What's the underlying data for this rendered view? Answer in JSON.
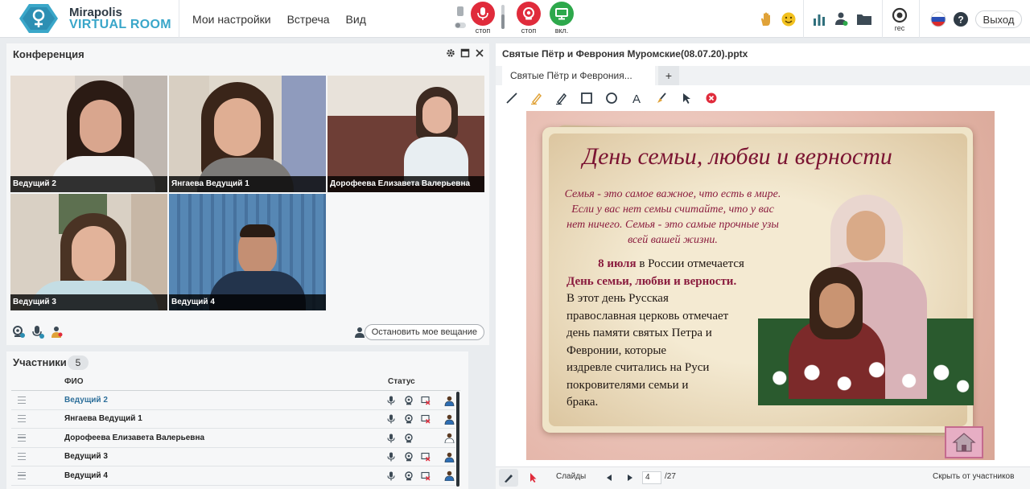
{
  "app": {
    "logo_line1": "Mirapolis",
    "logo_line2": "VIRTUAL ROOM",
    "menu": [
      "Мои настройки",
      "Встреча",
      "Вид"
    ],
    "media_buttons": [
      {
        "label": "стоп",
        "icon": "microphone-icon",
        "color": "#e02b3b"
      },
      {
        "label": "стоп",
        "icon": "webcam-icon",
        "color": "#e02b3b"
      },
      {
        "label": "вкл.",
        "icon": "screen-share-icon",
        "color": "#2da84b"
      }
    ],
    "rec_label": "rec",
    "exit_label": "Выход"
  },
  "conference": {
    "title": "Конференция",
    "videos": [
      {
        "name": "Ведущий 2"
      },
      {
        "name": "Янгаева Ведущий 1"
      },
      {
        "name": "Дорофеева Елизавета  Валерьевна"
      },
      {
        "name": "Ведущий 3"
      },
      {
        "name": "Ведущий 4"
      }
    ],
    "stop_broadcast_label": "Остановить мое вещание"
  },
  "participants": {
    "title": "Участники",
    "count": "5",
    "col_name": "ФИО",
    "col_status": "Статус",
    "rows": [
      {
        "name": "Ведущий 2",
        "highlight": true
      },
      {
        "name": "Янгаева Ведущий 1"
      },
      {
        "name": "Дорофеева Елизавета  Валерьевна"
      },
      {
        "name": "Ведущий 3"
      },
      {
        "name": "Ведущий 4"
      }
    ]
  },
  "presentation": {
    "file_title": "Святые Пётр и Феврония Муромские(08.07.20).pptx",
    "tab_label": "Святые Пётр и Феврония...",
    "tab_add": "+",
    "slide": {
      "heading": "День семьи, любви и верности",
      "quote": [
        "Семья - это самое важное, что есть в мире.",
        "Если у вас нет семьи считайте, что у вас",
        "нет ничего. Семья - это самые прочные узы",
        "всей вашей жизни."
      ],
      "body_date": "8 июля",
      "body_rest": " в России отмечается",
      "body_holiday": "День семьи, любви и верности.",
      "body_text": [
        "В этот день Русская",
        "православная церковь отмечает",
        "день памяти святых Петра и",
        "Февронии, которые",
        "издревле считались на Руси",
        "покровителями семьи и",
        "брака."
      ]
    },
    "slides_label": "Слайды",
    "current_slide": "4",
    "total_slides": "/27",
    "hide_label": "Скрыть от участников"
  }
}
